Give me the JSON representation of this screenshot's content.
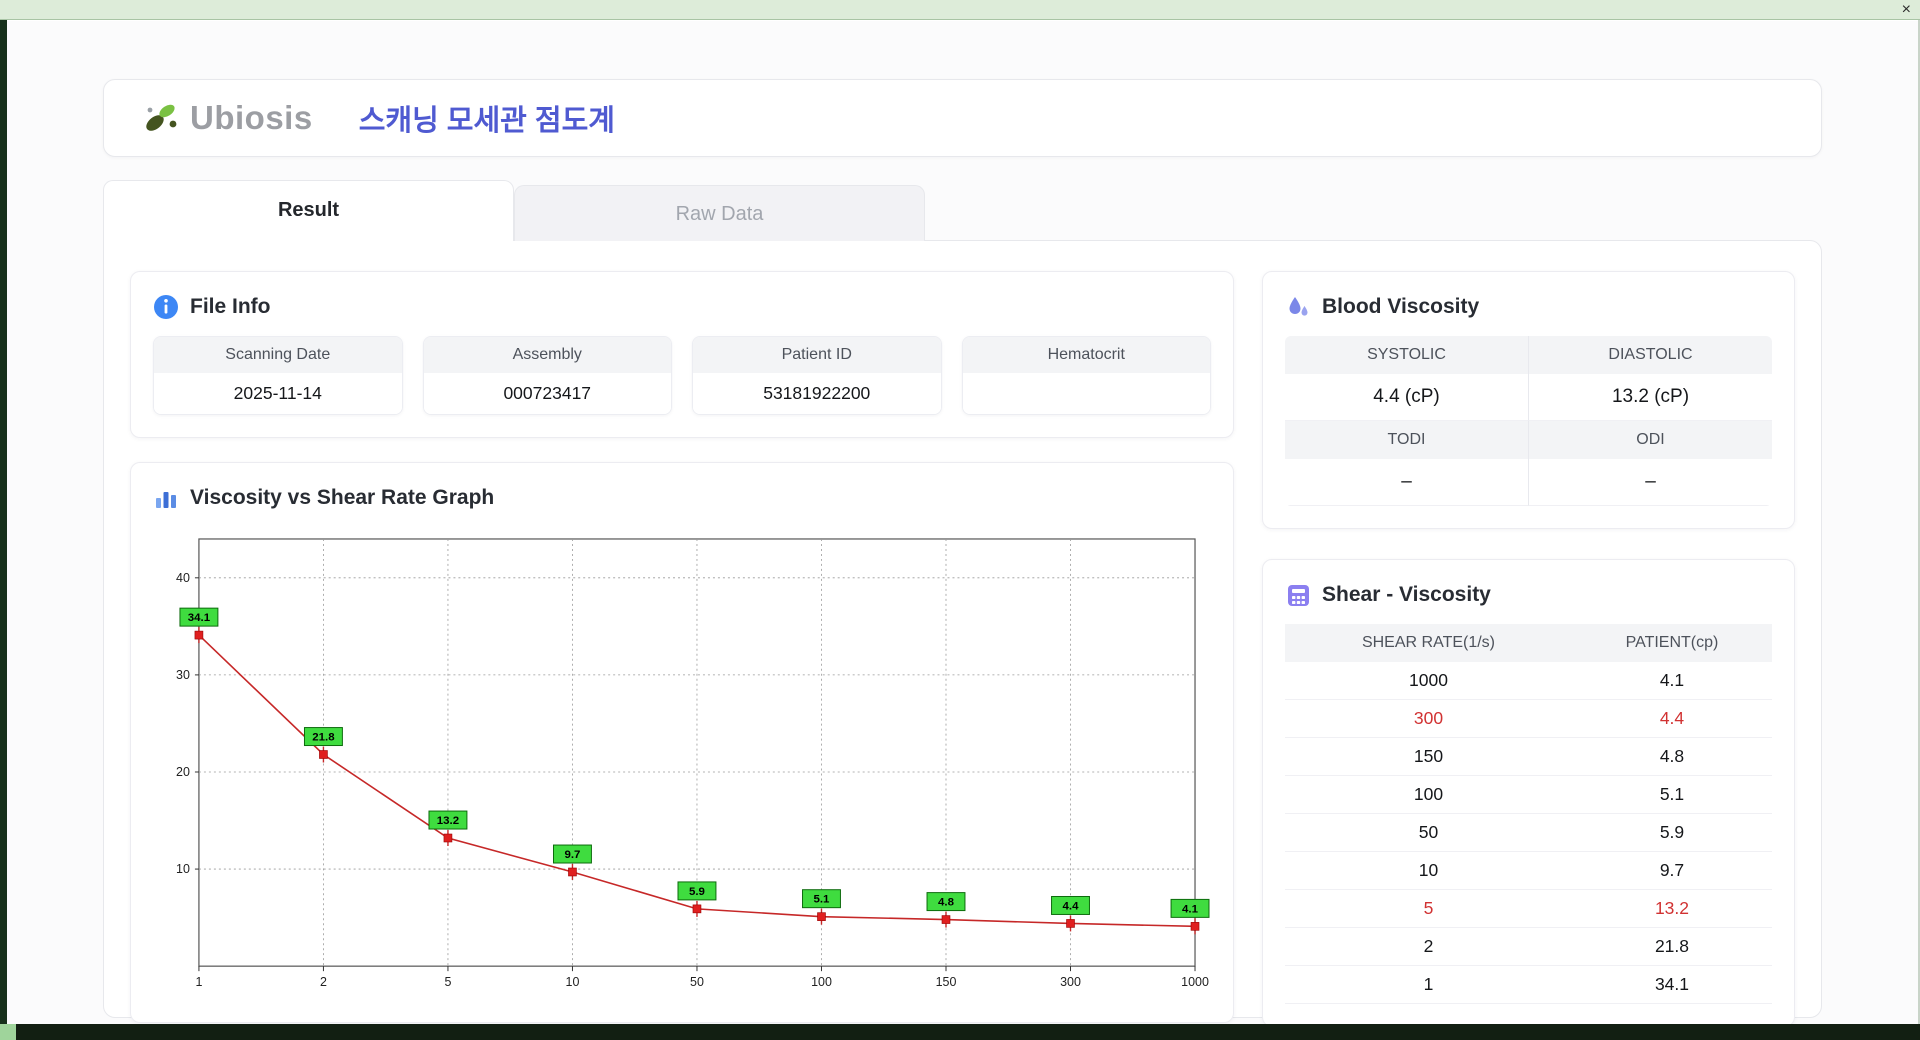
{
  "window": {
    "close_label": "×"
  },
  "header": {
    "logo_text": "Ubiosis",
    "title": "스캐닝 모세관 점도계"
  },
  "tabs": [
    {
      "label": "Result",
      "active": true
    },
    {
      "label": "Raw Data",
      "active": false
    }
  ],
  "file_info": {
    "title": "File Info",
    "fields": [
      {
        "label": "Scanning Date",
        "value": "2025-11-14"
      },
      {
        "label": "Assembly",
        "value": "000723417"
      },
      {
        "label": "Patient ID",
        "value": "53181922200"
      },
      {
        "label": "Hematocrit",
        "value": ""
      }
    ]
  },
  "blood_viscosity": {
    "title": "Blood Viscosity",
    "rows": [
      {
        "h1": "SYSTOLIC",
        "h2": "DIASTOLIC",
        "v1": "4.4 (cP)",
        "v2": "13.2 (cP)"
      },
      {
        "h1": "TODI",
        "h2": "ODI",
        "v1": "–",
        "v2": "–"
      }
    ]
  },
  "graph": {
    "title": "Viscosity vs Shear Rate Graph"
  },
  "chart_data": {
    "type": "line",
    "title": "Viscosity vs Shear Rate Graph",
    "x": [
      1,
      2,
      5,
      10,
      50,
      100,
      150,
      300,
      1000
    ],
    "x_ticks": [
      "1",
      "2",
      "5",
      "10",
      "50",
      "100",
      "150",
      "300",
      "1000"
    ],
    "values": [
      34.1,
      21.8,
      13.2,
      9.7,
      5.9,
      5.1,
      4.8,
      4.4,
      4.1
    ],
    "y_ticks": [
      10,
      20,
      30,
      40
    ],
    "ylim": [
      0,
      44
    ],
    "x_scale": "category",
    "grid": "dotted",
    "line_color": "#c62828",
    "marker_color": "#e01f1f",
    "label_bg": "#3fdc3f",
    "label_border": "#0c6b0c"
  },
  "shear_table": {
    "title": "Shear - Viscosity",
    "headers": [
      "SHEAR RATE(1/s)",
      "PATIENT(cp)"
    ],
    "rows": [
      {
        "rate": "1000",
        "patient": "4.1",
        "highlight": false
      },
      {
        "rate": "300",
        "patient": "4.4",
        "highlight": true
      },
      {
        "rate": "150",
        "patient": "4.8",
        "highlight": false
      },
      {
        "rate": "100",
        "patient": "5.1",
        "highlight": false
      },
      {
        "rate": "50",
        "patient": "5.9",
        "highlight": false
      },
      {
        "rate": "10",
        "patient": "9.7",
        "highlight": false
      },
      {
        "rate": "5",
        "patient": "13.2",
        "highlight": true
      },
      {
        "rate": "2",
        "patient": "21.8",
        "highlight": false
      },
      {
        "rate": "1",
        "patient": "34.1",
        "highlight": false
      }
    ]
  },
  "colors": {
    "accent_blue": "#4f5ad1",
    "highlight_red": "#d13232",
    "label_green": "#3fdc3f",
    "line_red": "#c62828",
    "frame_green_light": "#ddecd9",
    "frame_green_dark": "#17301b"
  }
}
